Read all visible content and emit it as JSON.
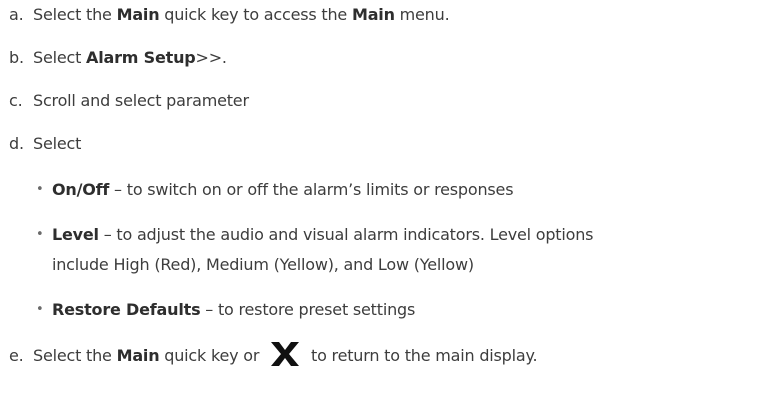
{
  "steps": {
    "a": {
      "letter": "a.",
      "t1": "Select the ",
      "b1": "Main",
      "t2": " quick key to access the ",
      "b2": "Main",
      "t3": " menu."
    },
    "b": {
      "letter": "b.",
      "t1": "Select ",
      "b1": "Alarm Setup",
      "t2": ">>."
    },
    "c": {
      "letter": "c.",
      "t1": "Scroll and select parameter"
    },
    "d": {
      "letter": "d.",
      "t1": "Select",
      "items": [
        {
          "bullet": "•",
          "bold": "On/Off",
          "text": " – to switch on or off the alarm’s limits or responses"
        },
        {
          "bullet": "•",
          "bold": "Level",
          "text_line1": " – to adjust the audio and visual alarm indicators. Level options",
          "text_line2": "include High (Red), Medium (Yellow), and Low (Yellow)"
        },
        {
          "bullet": "•",
          "bold": "Restore Defaults",
          "text": " – to restore preset settings"
        }
      ]
    },
    "e": {
      "letter": "e.",
      "t1": "Select the ",
      "b1": "Main",
      "t2": " quick key or ",
      "t3": " to return to the main display.",
      "icon": "close-x-icon"
    }
  }
}
